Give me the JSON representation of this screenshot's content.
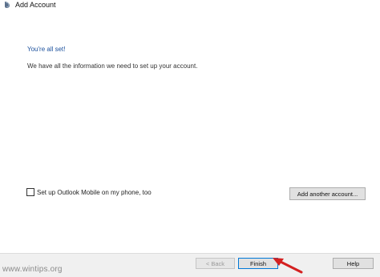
{
  "window": {
    "title": "Add Account",
    "icon": "outlook-account-icon"
  },
  "content": {
    "heading": "You're all set!",
    "info": "We have all the information we need to set up your account."
  },
  "options": {
    "mobile_checkbox_label": "Set up Outlook Mobile on my phone, too",
    "mobile_checkbox_checked": false,
    "add_another_label": "Add another account..."
  },
  "footer": {
    "back_label": "< Back",
    "finish_label": "Finish",
    "help_label": "Help"
  },
  "watermark": "www.wintips.org",
  "colors": {
    "heading": "#1a4f9c",
    "arrow": "#d42020",
    "focus_border": "#0078d7"
  }
}
